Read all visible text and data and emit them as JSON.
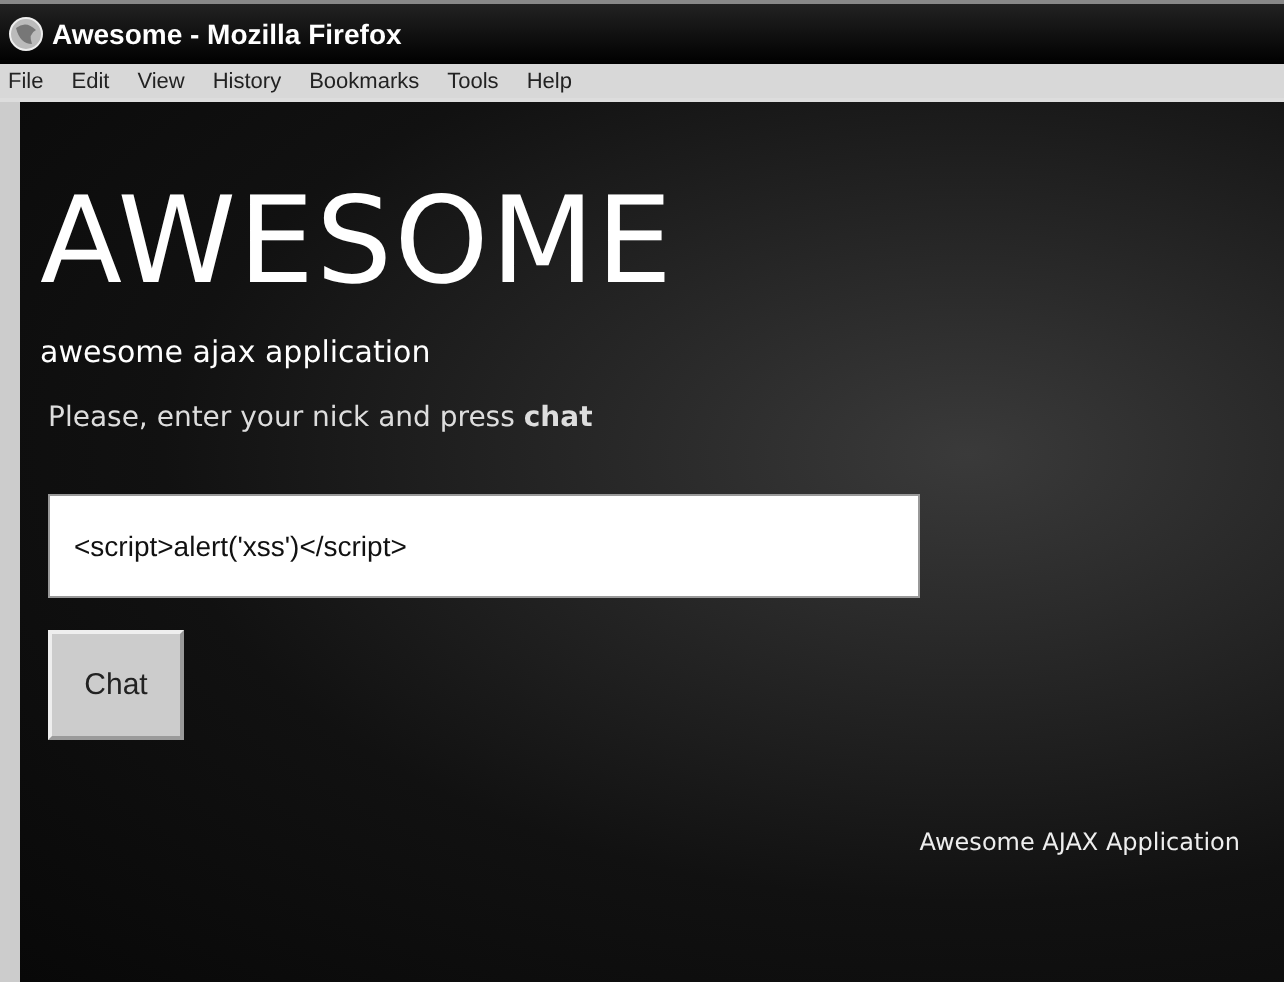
{
  "window": {
    "title": "Awesome - Mozilla Firefox"
  },
  "menu": [
    "File",
    "Edit",
    "View",
    "History",
    "Bookmarks",
    "Tools",
    "Help"
  ],
  "page": {
    "heading": "AWESOME",
    "subtitle": "awesome ajax application",
    "prompt": "Please, enter your nick and press **chat**",
    "nick_field": {
      "value": "<script>alert('xss')</script>"
    },
    "button": "Chat",
    "footer": "Awesome AJAX Application"
  }
}
